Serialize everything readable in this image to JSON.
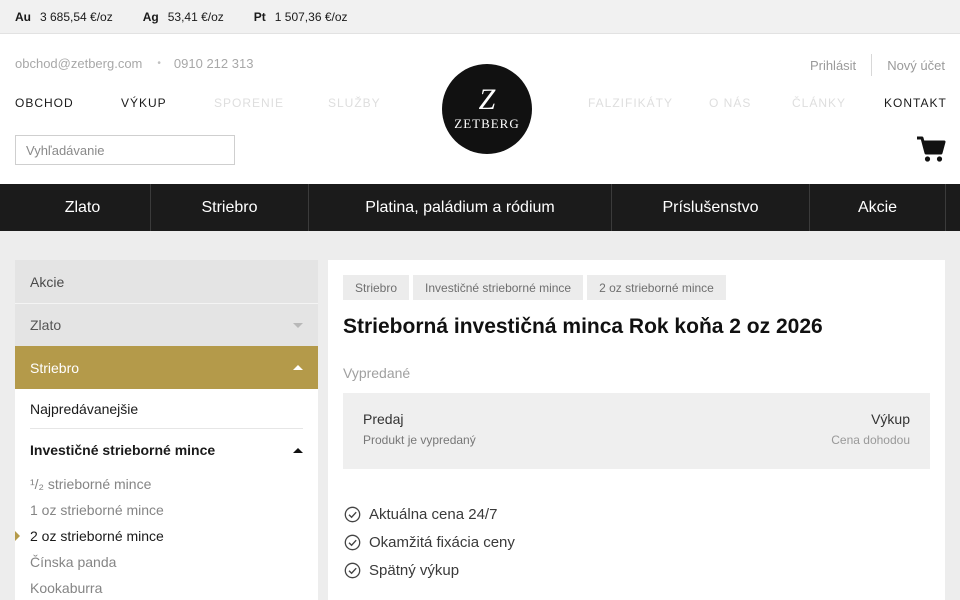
{
  "ticker": [
    {
      "symbol": "Au",
      "price": "3 685,54 €/oz"
    },
    {
      "symbol": "Ag",
      "price": "53,41 €/oz"
    },
    {
      "symbol": "Pt",
      "price": "1 507,36 €/oz"
    }
  ],
  "header": {
    "email": "obchod@zetberg.com",
    "phone": "0910 212 313",
    "login": "Prihlásit",
    "register": "Nový účet",
    "nav_left": [
      "OBCHOD",
      "VÝKUP",
      "SPORENIE",
      "SLUŽBY"
    ],
    "nav_right": [
      "FALZIFIKÁTY",
      "O NÁS",
      "ČLÁNKY",
      "KONTAKT"
    ],
    "logo": {
      "monogram": "Z",
      "wordmark": "ZETBERG"
    },
    "search_placeholder": "Vyhľadávanie",
    "cart_icon": "shopping-cart-icon"
  },
  "categories": [
    "Zlato",
    "Striebro",
    "Platina, paládium a ródium",
    "Príslušenstvo",
    "Akcie"
  ],
  "sidebar": {
    "top_items": [
      "Akcie",
      "Zlato",
      "Striebro"
    ],
    "active": "Striebro",
    "sub": {
      "bestsellers": "Najpredávanejšie",
      "group": "Investičné strieborné mince",
      "leaves": [
        "¹/₂ strieborné mince",
        "1 oz strieborné mince",
        "2 oz strieborné mince",
        "Čínska panda",
        "Kookaburra"
      ],
      "current_leaf": "2 oz strieborné mince"
    },
    "accent_color": "#b49a4a"
  },
  "product": {
    "breadcrumbs": [
      "Striebro",
      "Investičné strieborné mince",
      "2 oz strieborné mince"
    ],
    "title": "Strieborná investičná minca Rok koňa 2 oz 2026",
    "availability": "Vypredané",
    "sell_label": "Predaj",
    "sell_value": "Produkt je vypredaný",
    "buyback_label": "Výkup",
    "buyback_value": "Cena dohodou",
    "features": [
      "Aktuálna cena 24/7",
      "Okamžitá fixácia ceny",
      "Spätný výkup"
    ],
    "feature_icon": "check-circle-icon"
  }
}
